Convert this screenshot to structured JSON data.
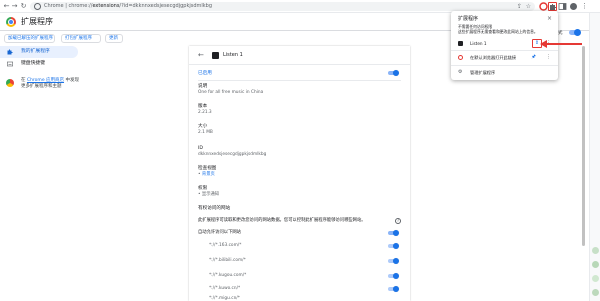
{
  "address": {
    "prefix": "Chrome",
    "separator": "|",
    "url_scheme": "chrome://",
    "url_host": "extensions",
    "url_rest": "/?id=dkknnxedsjesecgdjgpkjsdmlkbg"
  },
  "header": {
    "title": "扩展程序"
  },
  "toolbar_buttons": {
    "load_unpacked": "加载已解压的扩展程序",
    "pack": "打包扩展程序",
    "update": "更新"
  },
  "dev_mode": {
    "label": "开发者模式",
    "enabled": true
  },
  "sidebar": {
    "items": [
      {
        "label": "我的扩展程序",
        "active": true
      },
      {
        "label": "键盘快捷键",
        "active": false
      }
    ],
    "store_text_pre": "在 ",
    "store_link": "Chrome 应用商店",
    "store_text_post": " 中发现",
    "store_line2": "更多扩展程序和主题"
  },
  "detail": {
    "name": "Listen 1",
    "on_label": "已启用",
    "description_label": "说明",
    "description": "One for all free music in China",
    "version_label": "版本",
    "version": "2.21.3",
    "size_label": "大小",
    "size": "2.1 MB",
    "id_label": "ID",
    "id": "dkknnxedsjesecgdjgpkjsdmlkbg",
    "inspect_label": "检查视图",
    "inspect_link": "背景页",
    "perm_label": "权限",
    "perm_item": "显示通知",
    "site_label": "有权访问的网站",
    "site_desc": "此扩展程序可读取和更改您访问的网站数据。您可以控制此扩展程序能够访问哪些网站。",
    "auto_allow": "自动允许访问以下网站",
    "sites": [
      "*://*.163.com/*",
      "*://*.bilibili.com/*",
      "*://*.kugou.com/*",
      "*://*.kuwo.cn/*",
      "*://*.migu.cn/*",
      "*://*.qq.com/*"
    ]
  },
  "popup": {
    "title": "扩展程序",
    "subtitle_1": "不需要任何访问权限",
    "subtitle_2": "这些扩展程序无需查看和更改此网站上的信息。",
    "item_1": "Listen 1",
    "item_2": "在默认浏览器打开此链接",
    "manage": "管理扩展程序"
  },
  "colors": {
    "accent": "#1a73e8",
    "highlight": "#e53935",
    "active_bg": "#e8f0fe"
  }
}
